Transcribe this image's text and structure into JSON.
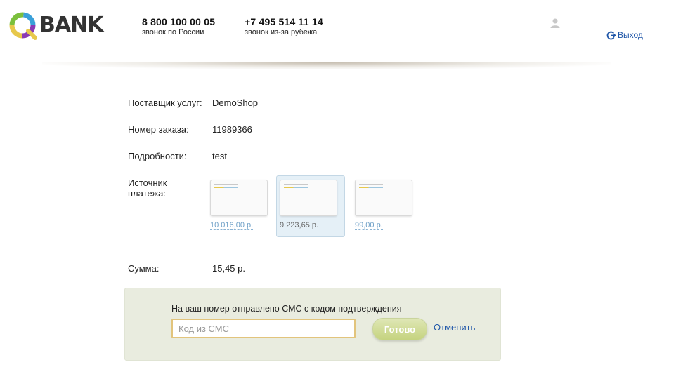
{
  "header": {
    "logo": {
      "text": "BANK",
      "icon": "q-ring-logo-icon",
      "colors": [
        "#8a3ab5",
        "#e7c84b",
        "#7bbf3d",
        "#3aa0d9"
      ]
    },
    "phones": [
      {
        "number": "8 800 100 00 05",
        "caption": "звонок по России"
      },
      {
        "number": "+7 495 514 11 14",
        "caption": "звонок из-за рубежа"
      }
    ],
    "user_icon": "user-icon",
    "logout": {
      "icon": "logout-icon",
      "label": "Выход"
    }
  },
  "order": {
    "provider": {
      "label": "Поставщик услуг:",
      "value": "DemoShop"
    },
    "order_number": {
      "label": "Номер заказа:",
      "value": "11989366"
    },
    "details": {
      "label": "Подробности:",
      "value": "test"
    },
    "payment_source": {
      "label": "Источник платежа:",
      "cards": [
        {
          "amount": "10 016,00 р.",
          "selected": false
        },
        {
          "amount": "9 223,65 р.",
          "selected": true
        },
        {
          "amount": "99,00 р.",
          "selected": false
        }
      ]
    },
    "sum": {
      "label": "Сумма:",
      "value": "15,45 р."
    }
  },
  "sms": {
    "title": "На ваш номер отправлено СМС с кодом подтверждения",
    "input": {
      "value": "",
      "placeholder": "Код из СМС"
    },
    "submit_label": "Готово",
    "cancel_label": "Отменить"
  },
  "colors": {
    "link": "#1f56a8",
    "panel_bg": "#e9ecdf",
    "input_border": "#e2c47c",
    "button": "#c5d37f",
    "selected_card_bg": "#e5f0f7"
  }
}
